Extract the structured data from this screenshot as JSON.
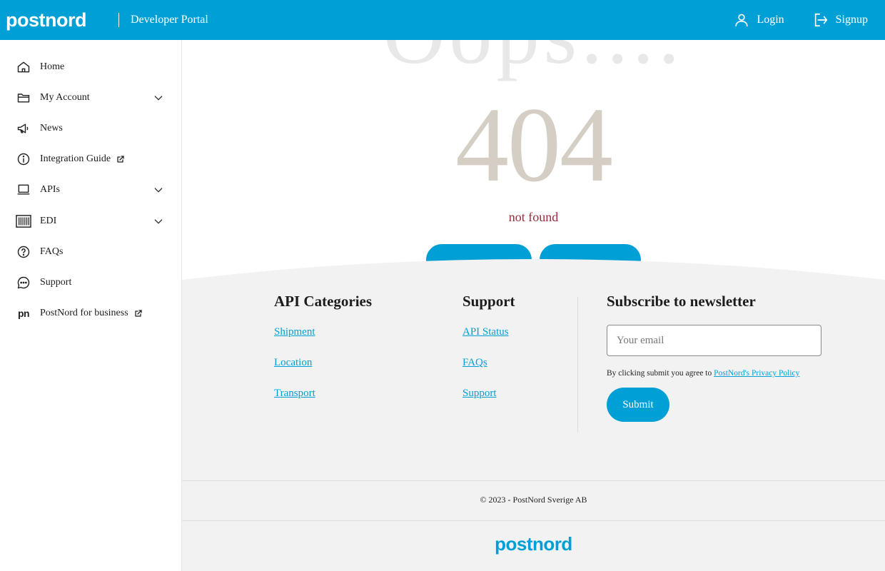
{
  "header": {
    "logo": "postnord",
    "portal_title": "Developer Portal",
    "login_label": "Login",
    "signup_label": "Signup",
    "brand_color": "#00a0d6"
  },
  "sidebar": {
    "items": [
      {
        "label": "Home",
        "icon": "home-icon"
      },
      {
        "label": "My Account",
        "icon": "folder-icon",
        "expandable": true
      },
      {
        "label": "News",
        "icon": "megaphone-icon"
      },
      {
        "label": "Integration Guide",
        "icon": "info-icon",
        "external": true
      },
      {
        "label": "APIs",
        "icon": "laptop-icon",
        "expandable": true
      },
      {
        "label": "EDI",
        "icon": "barcode-icon",
        "expandable": true
      },
      {
        "label": "FAQs",
        "icon": "question-icon"
      },
      {
        "label": "Support",
        "icon": "chat-icon"
      },
      {
        "label": "PostNord for business",
        "icon": "pn-icon",
        "external": true
      }
    ]
  },
  "main": {
    "oops": "Oops....",
    "code": "404",
    "message": "not found"
  },
  "footer": {
    "api_categories": {
      "title": "API Categories",
      "links": [
        "Shipment",
        "Location",
        "Transport"
      ]
    },
    "support": {
      "title": "Support",
      "links": [
        "API Status",
        "FAQs",
        "Support"
      ]
    },
    "newsletter": {
      "title": "Subscribe to newsletter",
      "email_placeholder": "Your email",
      "consent_text": "By clicking submit you agree to ",
      "privacy_link": "PostNord's Privacy Policy",
      "submit_label": "Submit"
    },
    "copyright": "© 2023 - PostNord Sverige AB",
    "logo": "postnord"
  }
}
